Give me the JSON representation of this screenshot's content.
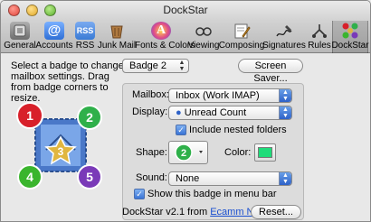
{
  "window": {
    "title": "DockStar"
  },
  "toolbar": {
    "items": [
      {
        "label": "General",
        "icon": "general-switch-icon",
        "color": "#8a8a8a"
      },
      {
        "label": "Accounts",
        "icon": "at-sign-icon",
        "color": "#2f6fd6"
      },
      {
        "label": "RSS",
        "icon": "rss-icon",
        "color": "#3a7bd5"
      },
      {
        "label": "Junk Mail",
        "icon": "junk-mail-bin-icon",
        "color": "#8b5a2b"
      },
      {
        "label": "Fonts & Colors",
        "icon": "fonts-colors-icon",
        "color": "#6a3fb0"
      },
      {
        "label": "Viewing",
        "icon": "viewing-glasses-icon",
        "color": "#555555"
      },
      {
        "label": "Composing",
        "icon": "composing-pencil-icon",
        "color": "#4a7aa8"
      },
      {
        "label": "Signatures",
        "icon": "signatures-pen-icon",
        "color": "#333333"
      },
      {
        "label": "Rules",
        "icon": "rules-icon",
        "color": "#444444"
      },
      {
        "label": "DockStar",
        "icon": "dockstar-icon",
        "color": "#2a5fc0",
        "selected": true
      }
    ]
  },
  "main": {
    "instructions": "Select a badge to change mailbox settings.  Drag from badge corners to resize.",
    "badge_popup": {
      "value": "Badge 2"
    },
    "screen_saver_button": "Screen Saver...",
    "badges": [
      {
        "number": "1",
        "color": "#d8202a"
      },
      {
        "number": "2",
        "color": "#2fb04a"
      },
      {
        "number": "3",
        "color": "#e0b640"
      },
      {
        "number": "4",
        "color": "#3ab52d"
      },
      {
        "number": "5",
        "color": "#7a3ab8"
      }
    ],
    "settings": {
      "mailbox_label": "Mailbox:",
      "mailbox_value": "Inbox (Work IMAP)",
      "display_label": "Display:",
      "display_value": "Unread Count",
      "include_nested_label": "Include nested folders",
      "include_nested_checked": true,
      "shape_label": "Shape:",
      "shape_badge_number": "2",
      "shape_badge_color": "#2fb04a",
      "color_label": "Color:",
      "color_value": "#1fdc7a",
      "sound_label": "Sound:",
      "sound_value": "None",
      "show_badge_label": "Show this badge in menu bar",
      "show_badge_checked": true
    },
    "footer": {
      "version_text": "DockStar v2.1 from",
      "link_text": "Ecamm Network",
      "reset_button": "Reset..."
    }
  }
}
